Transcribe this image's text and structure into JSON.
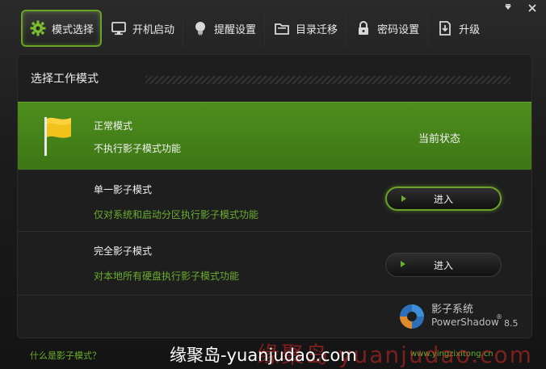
{
  "window": {
    "controls": [
      "▾",
      "✕"
    ]
  },
  "toolbar": {
    "tabs": [
      {
        "label": "模式选择",
        "icon": "gear-icon",
        "active": true
      },
      {
        "label": "开机启动",
        "icon": "monitor-icon"
      },
      {
        "label": "提醒设置",
        "icon": "lightbulb-icon"
      },
      {
        "label": "目录迁移",
        "icon": "folder-icon"
      },
      {
        "label": "密码设置",
        "icon": "lock-icon"
      },
      {
        "label": "升级",
        "icon": "download-icon"
      }
    ]
  },
  "panel": {
    "title": "选择工作模式",
    "modes": {
      "normal": {
        "title": "正常模式",
        "desc": "不执行影子模式功能",
        "status": "当前状态",
        "icon": "flag-icon"
      },
      "single": {
        "title": "单一影子模式",
        "desc": "仅对系统和启动分区执行影子模式功能",
        "button": "进入"
      },
      "full": {
        "title": "完全影子模式",
        "desc": "对本地所有硬盘执行影子模式功能",
        "button": "进入"
      }
    },
    "brand": {
      "name_cn": "影子系统",
      "name_en": "PowerShadow",
      "reg": "®",
      "version": "8.5"
    }
  },
  "footer": {
    "help": "什么是影子模式？",
    "site": "www.yingzixitong.cn"
  },
  "overlay": {
    "watermark": "缘聚岛-yuanjudao.com",
    "watermark_red": "缘聚岛 yuanjudao.com"
  },
  "colors": {
    "accent": "#6aa22a",
    "green_text": "#6aae2e",
    "active_row": "#4a8a1c"
  }
}
